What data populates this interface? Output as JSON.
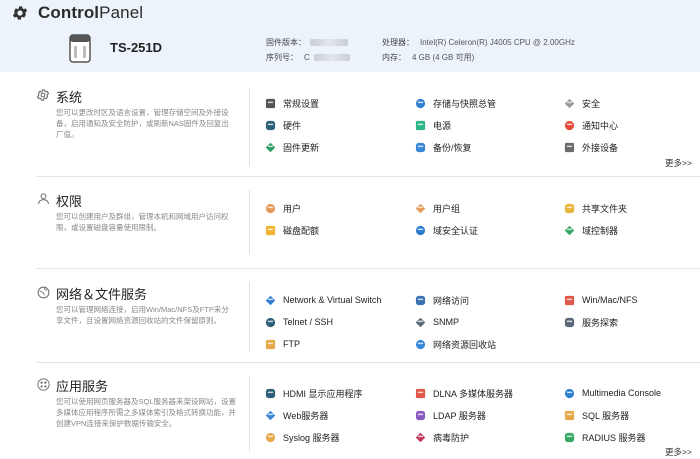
{
  "app": {
    "title_bold": "Control",
    "title_light": "Panel"
  },
  "device": {
    "model": "TS-251D",
    "firmware_label": "固件版本：",
    "serial_label": "序列号：",
    "serial_prefix": "C",
    "cpu_label": "处理器：",
    "cpu_value": "Intel(R) Celeron(R) J4005 CPU @ 2.00GHz",
    "memory_label": "内存：",
    "memory_value": "4 GB (4 GB 可用)"
  },
  "sections": [
    {
      "title": "系统",
      "icon": "gear-icon",
      "description": "您可以更改时区及语言设置，管理存储空间及外接设备，启用通知及安全防护，或刷新NAS固件及回复出厂值。",
      "items": [
        {
          "label": "常规设置",
          "icon": "general-settings-icon",
          "color": "#555555"
        },
        {
          "label": "存储与快照总管",
          "icon": "storage-icon",
          "color": "#2f7fd0"
        },
        {
          "label": "安全",
          "icon": "lock-icon",
          "color": "#9a9a9a"
        },
        {
          "label": "硬件",
          "icon": "hardware-icon",
          "color": "#2d5f78"
        },
        {
          "label": "电源",
          "icon": "power-icon",
          "color": "#2fb58a"
        },
        {
          "label": "通知中心",
          "icon": "notification-icon",
          "color": "#e6483a"
        },
        {
          "label": "固件更新",
          "icon": "firmware-update-icon",
          "color": "#2f9a5f"
        },
        {
          "label": "备份/恢复",
          "icon": "backup-icon",
          "color": "#3a87d8"
        },
        {
          "label": "外接设备",
          "icon": "external-device-icon",
          "color": "#6a6a6a"
        }
      ],
      "more": "更多>>"
    },
    {
      "title": "权限",
      "icon": "user-outline-icon",
      "description": "您可以创建用户及群组，管理本机和网域用户访问权限，或设置磁盘容量使用限制。",
      "items": [
        {
          "label": "用户",
          "icon": "user-icon",
          "color": "#e49a5a"
        },
        {
          "label": "用户组",
          "icon": "user-group-icon",
          "color": "#e49a5a"
        },
        {
          "label": "共享文件夹",
          "icon": "shared-folder-icon",
          "color": "#e8b53a"
        },
        {
          "label": "磁盘配额",
          "icon": "disk-quota-icon",
          "color": "#f2b233"
        },
        {
          "label": "域安全认证",
          "icon": "domain-security-icon",
          "color": "#2a7bd1"
        },
        {
          "label": "域控制器",
          "icon": "domain-controller-icon",
          "color": "#3aa866"
        }
      ],
      "more": ""
    },
    {
      "title": "网络＆文件服务",
      "icon": "globe-icon",
      "description": "您可以管理网络连接，启用Win/Mac/NFS及FTP来分享文件，且设置网络资源回收站的文件保留原则。",
      "items": [
        {
          "label": "Network & Virtual Switch",
          "icon": "network-switch-icon",
          "color": "#2f7fd0"
        },
        {
          "label": "网络访问",
          "icon": "network-access-icon",
          "color": "#3a6fb0"
        },
        {
          "label": "Win/Mac/NFS",
          "icon": "win-mac-nfs-icon",
          "color": "#e0574a"
        },
        {
          "label": "Telnet / SSH",
          "icon": "terminal-icon",
          "color": "#2d5f78"
        },
        {
          "label": "SNMP",
          "icon": "snmp-icon",
          "color": "#5a6a7a"
        },
        {
          "label": "服务探索",
          "icon": "service-discovery-icon",
          "color": "#5a6a7a"
        },
        {
          "label": "FTP",
          "icon": "ftp-icon",
          "color": "#e6a94a"
        },
        {
          "label": "网络资源回收站",
          "icon": "recycle-bin-icon",
          "color": "#3a87d8"
        }
      ],
      "more": ""
    },
    {
      "title": "应用服务",
      "icon": "apps-icon",
      "description": "您可以使用网页服务器及SQL服务器来架设网站，设置多媒体应用程序所需之多媒体索引及格式转换功能，并创建VPN连接来保护数据传输安全。",
      "items": [
        {
          "label": "HDMI 显示应用程序",
          "icon": "hdmi-icon",
          "color": "#2d5f78"
        },
        {
          "label": "DLNA 多媒体服务器",
          "icon": "dlna-icon",
          "color": "#e0574a"
        },
        {
          "label": "Multimedia Console",
          "icon": "multimedia-console-icon",
          "color": "#2f7fd0"
        },
        {
          "label": "Web服务器",
          "icon": "web-server-icon",
          "color": "#3a87d8"
        },
        {
          "label": "LDAP 服务器",
          "icon": "ldap-icon",
          "color": "#8a5ac0"
        },
        {
          "label": "SQL 服务器",
          "icon": "sql-server-icon",
          "color": "#e6a94a"
        },
        {
          "label": "Syslog 服务器",
          "icon": "syslog-icon",
          "color": "#e6a94a"
        },
        {
          "label": "病毒防护",
          "icon": "antivirus-icon",
          "color": "#c0395a"
        },
        {
          "label": "RADIUS 服务器",
          "icon": "radius-icon",
          "color": "#3aa866"
        }
      ],
      "more": "更多>>"
    }
  ]
}
